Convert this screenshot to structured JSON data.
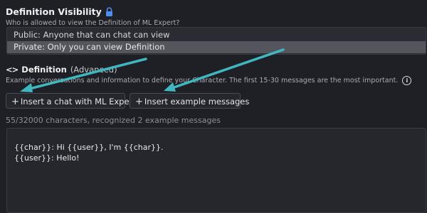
{
  "visibility": {
    "title": "Definition Visibility",
    "subtitle": "Who is allowed to view the Definition of ML Expert?",
    "options": [
      "Public: Anyone that can chat can view",
      "Private: Only you can view Definition"
    ],
    "selected": "Private: Only you can view Definition"
  },
  "definition": {
    "title": "Definition",
    "title_suffix": "(Advanced)",
    "subtitle": "Example conversations and information to define your Character. The first 15-30 messages are the most important."
  },
  "buttons": {
    "insert_chat": "Insert a chat with ML Expert",
    "insert_examples": "Insert example messages"
  },
  "status": {
    "count": "55/32000 characters, recognized 2 example messages"
  },
  "editor": {
    "lines": [
      "{{char}}: Hi {{user}}, I'm {{char}}.",
      "{{user}}: Hello!"
    ]
  },
  "annotation": {
    "arrow_color": "#3fb6c0"
  }
}
